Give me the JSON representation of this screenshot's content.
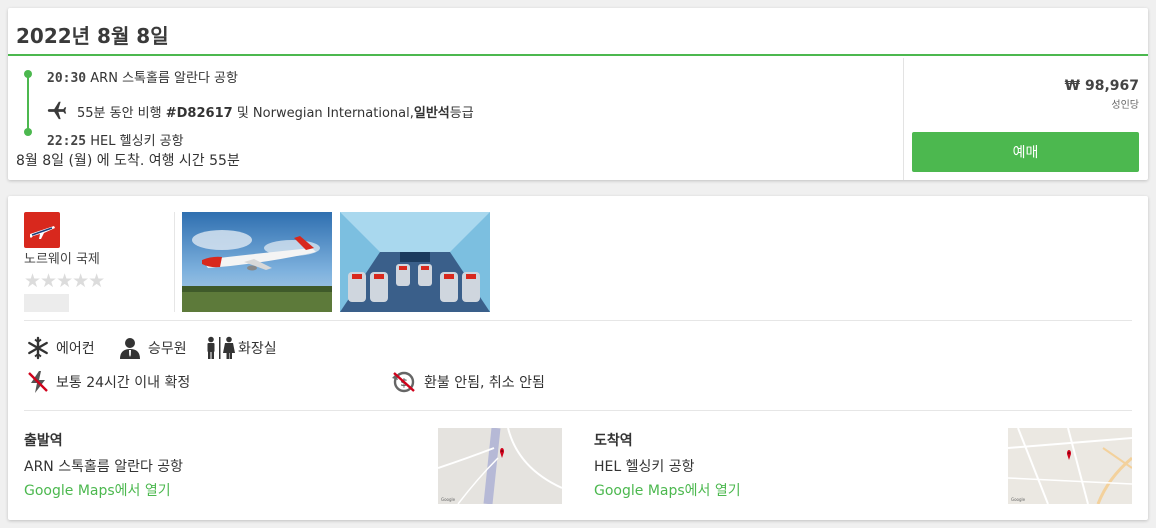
{
  "flight": {
    "date_title": "2022년 8월 8일",
    "depart_time": "20:30",
    "depart_airport": "ARN 스톡홀름 알란다 공항",
    "duration_prefix": "55분 동안 비행",
    "flight_number": "#D82617",
    "connector": "및",
    "airline": "Norwegian International,",
    "cabin_class": "일반석",
    "cabin_suffix": "등급",
    "arrive_time": "22:25",
    "arrive_airport": "HEL 헬싱키 공항",
    "arrival_summary": "8월 8일 (월) 에 도착. 여행 시간 55분"
  },
  "booking": {
    "price": "₩ 98,967",
    "per_person": "성인당",
    "book_label": "예매"
  },
  "airline_info": {
    "name": "노르웨이 국제",
    "rating_stars": "★★★★★",
    "logo_color": "#d8281d"
  },
  "amenities": {
    "ac": "에어컨",
    "crew": "승무원",
    "toilet": "화장실",
    "confirm": "보통 24시간 이내 확정",
    "refund": "환불 안됨, 취소 안됨"
  },
  "locations": {
    "departure": {
      "heading": "출발역",
      "name": "ARN 스톡홀름 알란다 공항",
      "maps_link": "Google Maps에서 열기"
    },
    "arrival": {
      "heading": "도착역",
      "name": "HEL 헬싱키 공항",
      "maps_link": "Google Maps에서 열기"
    }
  },
  "colors": {
    "accent": "#4cb84f",
    "pin": "#d0021b"
  }
}
